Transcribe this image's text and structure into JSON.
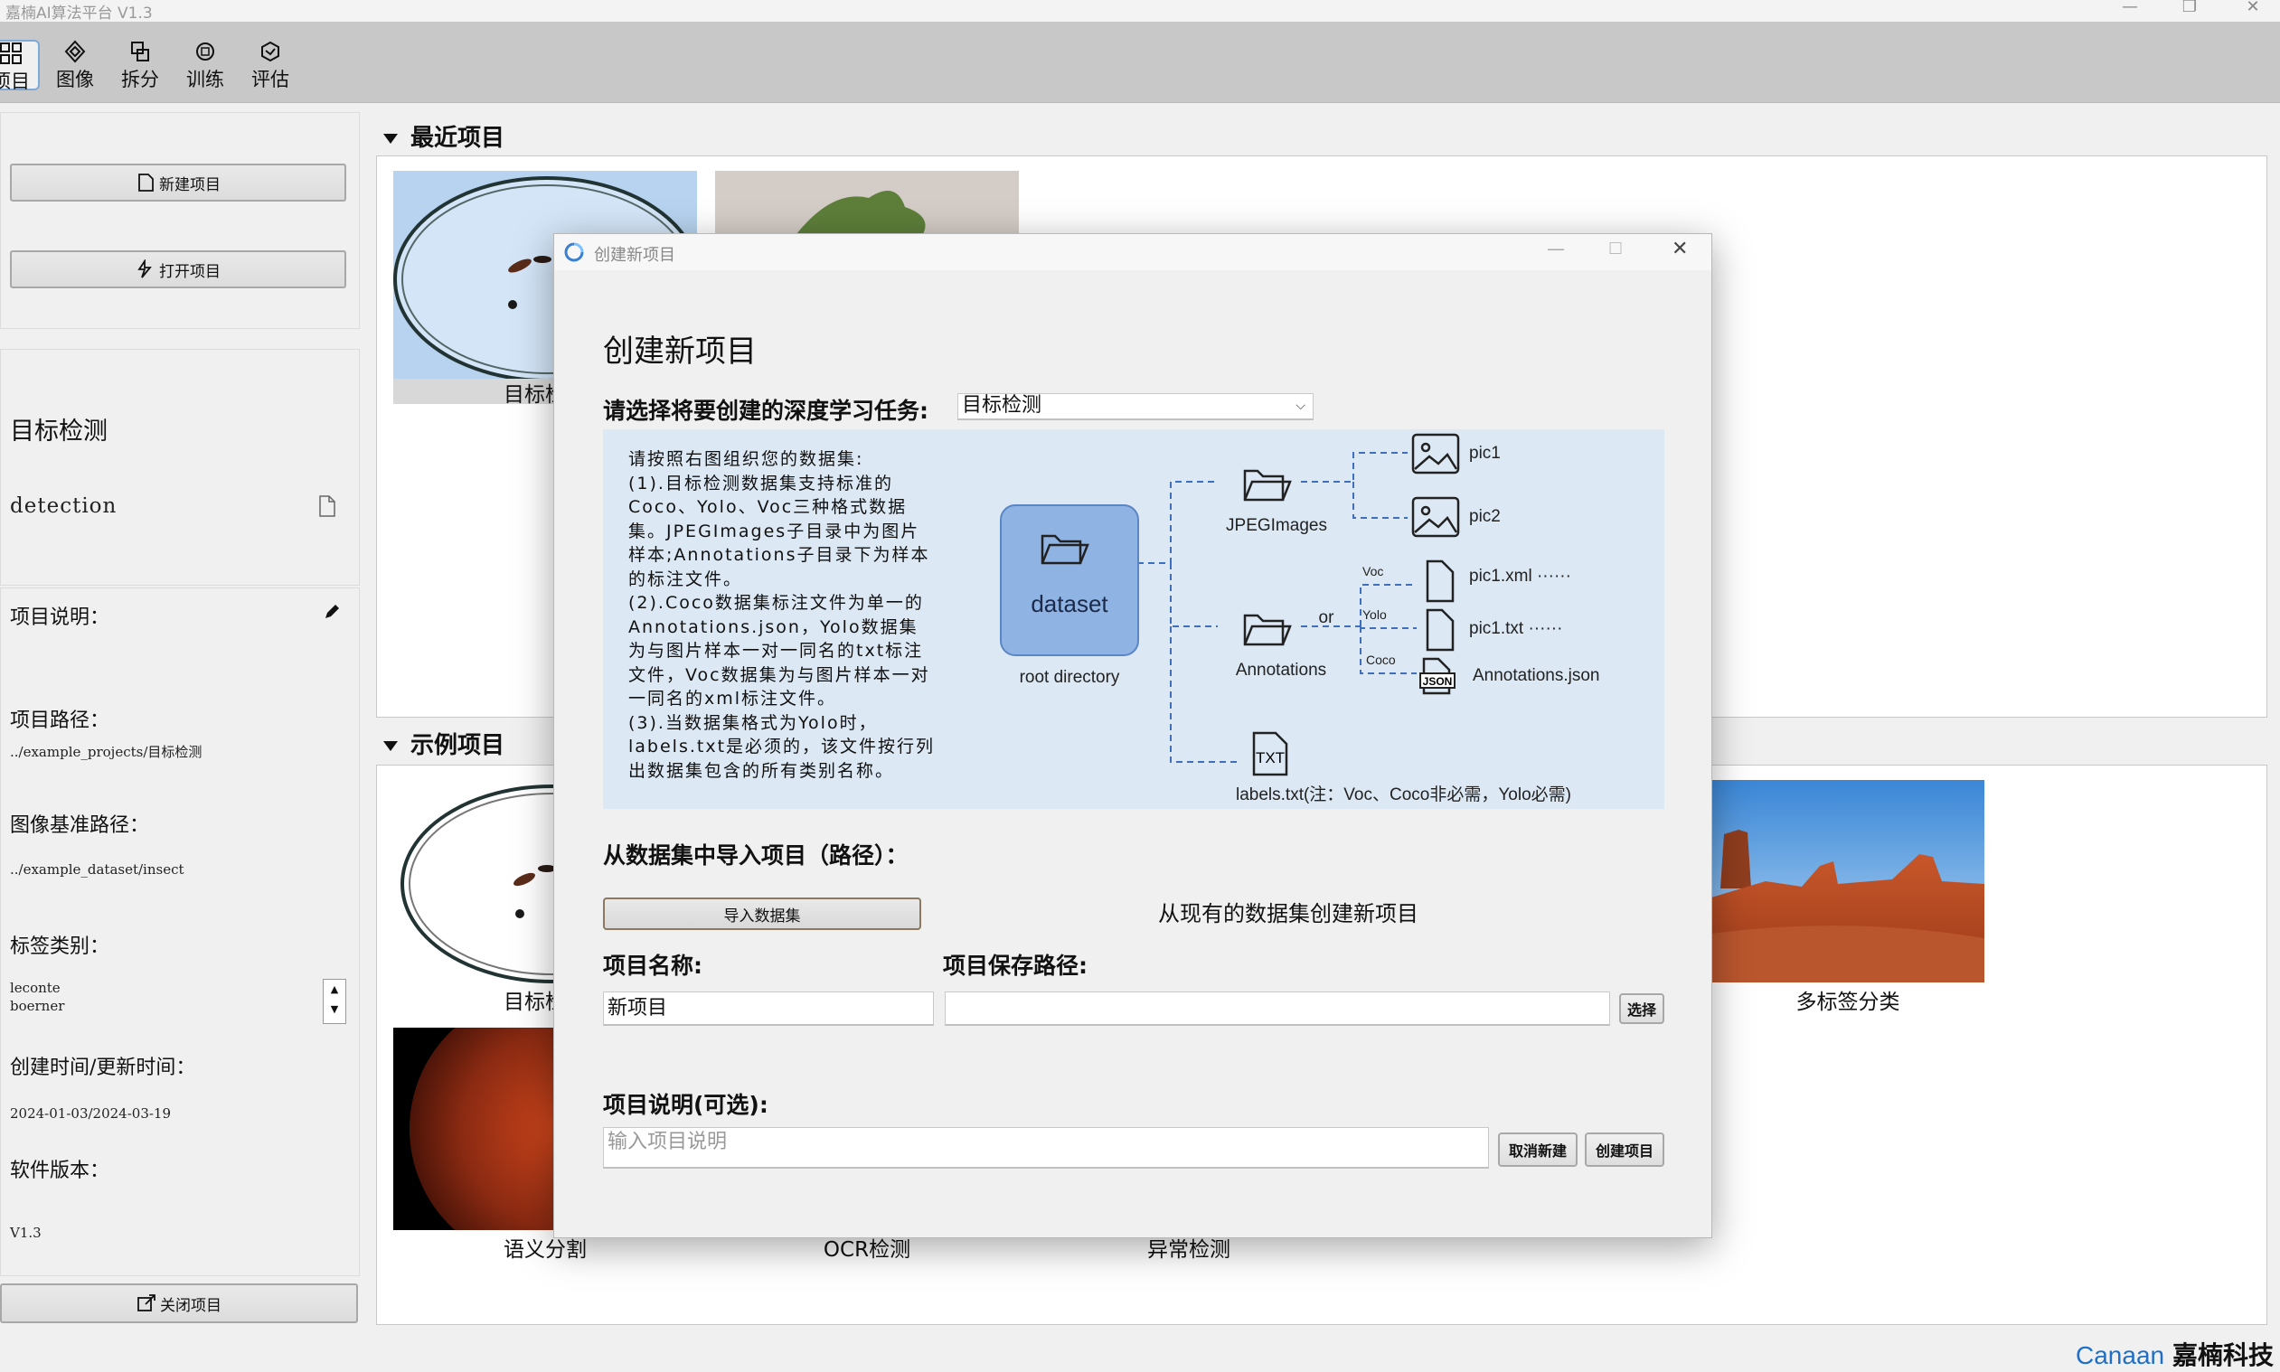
{
  "window": {
    "title": "嘉楠AI算法平台 V1.3"
  },
  "toolbar": {
    "items": [
      {
        "label": "项目"
      },
      {
        "label": "图像"
      },
      {
        "label": "拆分"
      },
      {
        "label": "训练"
      },
      {
        "label": "评估"
      }
    ]
  },
  "sidebar": {
    "new_project": "新建项目",
    "open_project": "打开项目",
    "project_title": "目标检测",
    "project_type": "detection",
    "desc_label": "项目说明：",
    "path_label": "项目路径：",
    "path_value": "../example_projects/目标检测",
    "img_path_label": "图像基准路径：",
    "img_path_value": "../example_dataset/insect",
    "labels_label": "标签类别：",
    "labels": [
      "leconte",
      "boerner"
    ],
    "time_label": "创建时间/更新时间：",
    "time_value": "2024-01-03/2024-03-19",
    "version_label": "软件版本：",
    "version_value": "V1.3",
    "close_project": "关闭项目"
  },
  "recent": {
    "title": "最近项目",
    "items": [
      {
        "label": "目标检测"
      },
      {
        "label": ""
      }
    ]
  },
  "examples": {
    "title": "示例项目",
    "items": [
      {
        "label": "目标检测"
      },
      {
        "label": "多标签分类"
      },
      {
        "label": "语义分割"
      },
      {
        "label": "OCR检测"
      },
      {
        "label": "异常检测"
      }
    ]
  },
  "dialog": {
    "title": "创建新项目",
    "heading": "创建新项目",
    "task_label": "请选择将要创建的深度学习任务:",
    "task_value": "目标检测",
    "instructions": "请按照右图组织您的数据集:\n(1).目标检测数据集支持标准的Coco、Yolo、Voc三种格式数据集。JPEGImages子目录中为图片样本;Annotations子目录下为样本的标注文件。\n(2).Coco数据集标注文件为单一的Annotations.json，Yolo数据集为与图片样本一对一同名的txt标注文件，Voc数据集为与图片样本一对一同名的xml标注文件。\n(3).当数据集格式为Yolo时，labels.txt是必须的，该文件按行列出数据集包含的所有类别名称。",
    "diagram": {
      "dataset": "dataset",
      "root": "root directory",
      "jpeg": "JPEGImages",
      "annotations": "Annotations",
      "or": "or",
      "pic1": "pic1",
      "pic2": "pic2",
      "voc": "Voc",
      "yolo": "Yolo",
      "coco": "Coco",
      "xml": "pic1.xml ······",
      "txt": "pic1.txt ······",
      "json": "Annotations.json",
      "json_badge": "JSON",
      "txt_badge": "TXT",
      "labels": "labels.txt(注：Voc、Coco非必需，Yolo必需)"
    },
    "import_label": "从数据集中导入项目（路径）：",
    "import_button": "导入数据集",
    "import_hint": "从现有的数据集创建新项目",
    "name_label": "项目名称:",
    "name_value": "新项目",
    "save_path_label": "项目保存路径:",
    "save_path_value": "",
    "choose_button": "选择",
    "desc_label": "项目说明(可选):",
    "desc_placeholder": "输入项目说明",
    "cancel_button": "取消新建",
    "create_button": "创建项目"
  },
  "brand": {
    "en": "Canaan",
    "cn": "嘉楠科技"
  },
  "colors": {
    "toolbar": "#c8c8c8",
    "accent": "#7da8d8",
    "info_bg": "#dce8f4",
    "dataset_box": "#8fb3e3",
    "brand_blue": "#1f6fc5"
  }
}
